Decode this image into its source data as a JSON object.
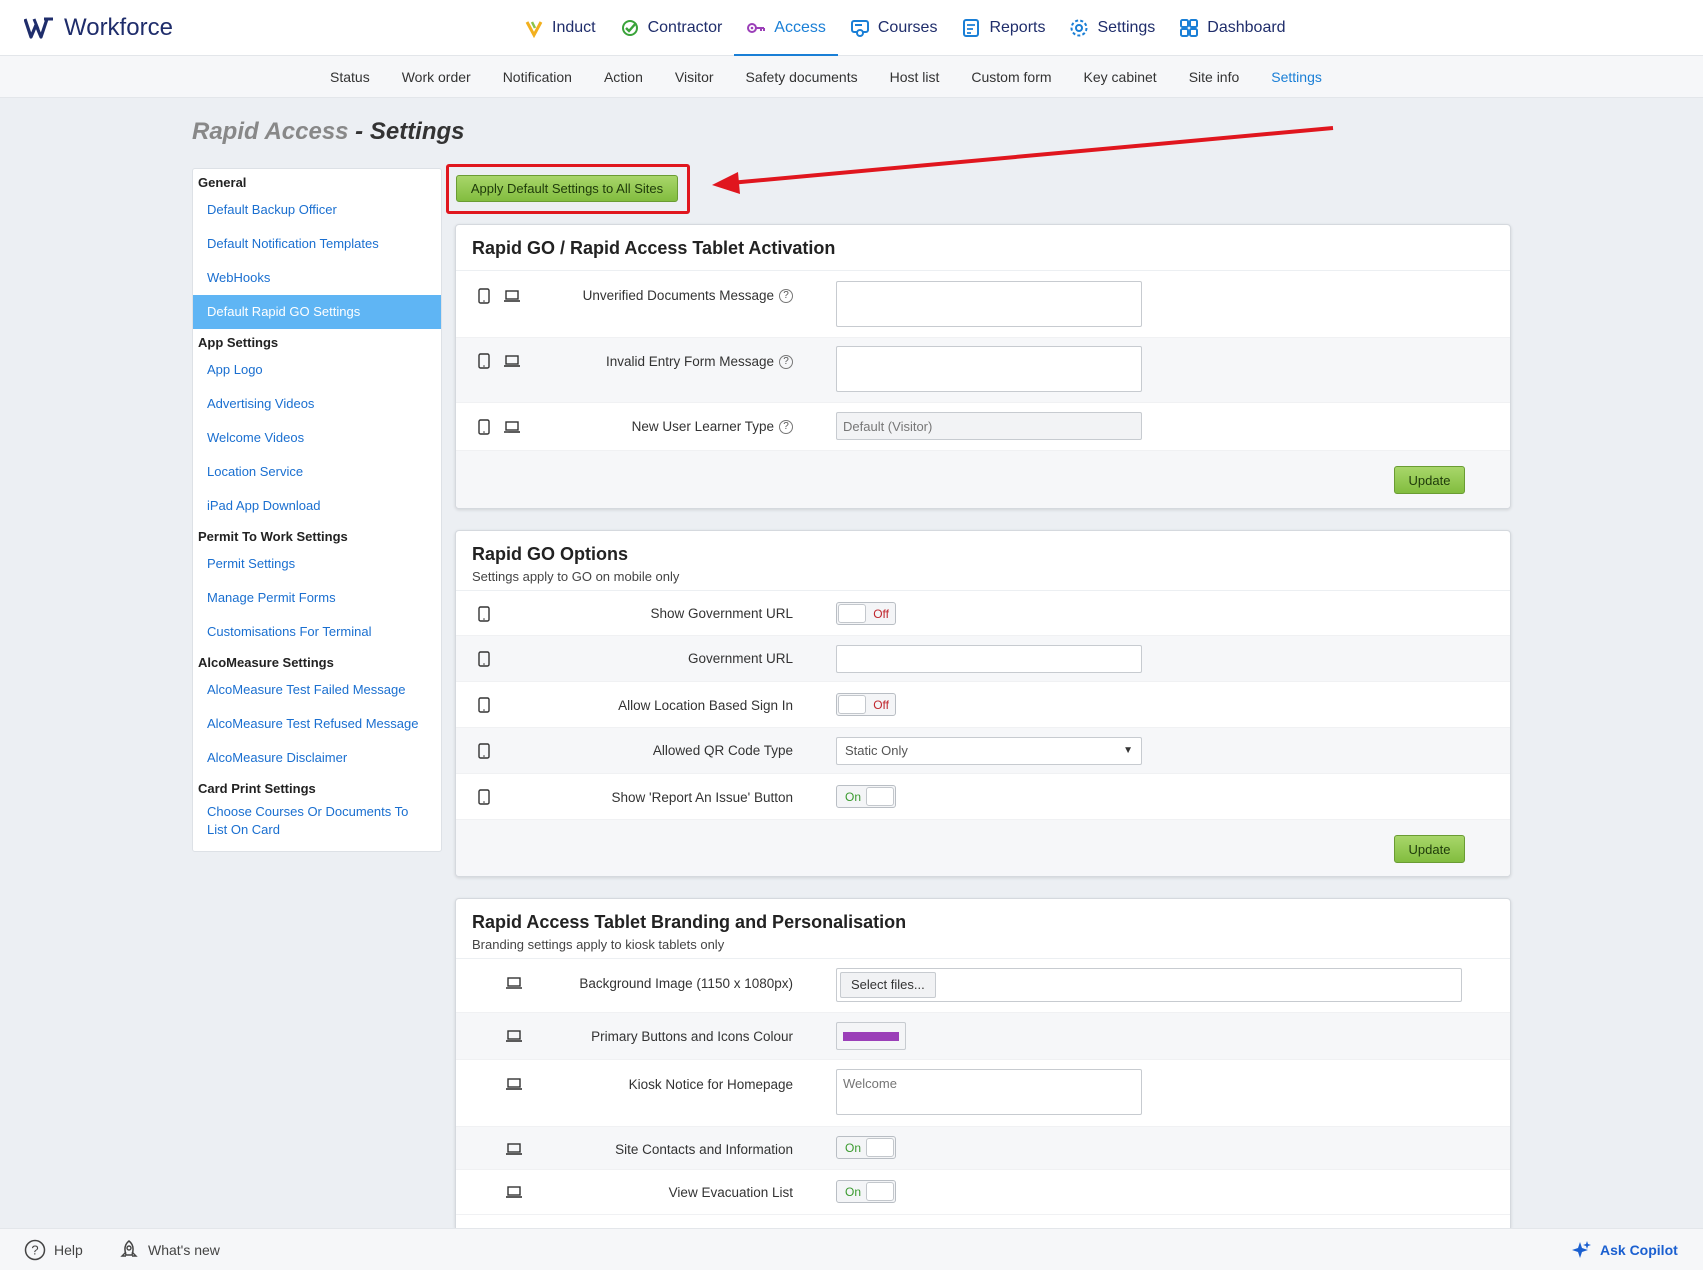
{
  "brand": {
    "name": "Workforce"
  },
  "main_nav": [
    {
      "label": "Induct",
      "icon": "induct-icon",
      "color": "#f2b01e"
    },
    {
      "label": "Contractor",
      "icon": "check-circle-icon",
      "color": "#3aa33a"
    },
    {
      "label": "Access",
      "icon": "key-icon",
      "color": "#9b3fb8"
    },
    {
      "label": "Courses",
      "icon": "courses-icon",
      "color": "#1a7fd6"
    },
    {
      "label": "Reports",
      "icon": "reports-icon",
      "color": "#1a7fd6"
    },
    {
      "label": "Settings",
      "icon": "gear-icon",
      "color": "#1a7fd6"
    },
    {
      "label": "Dashboard",
      "icon": "dashboard-icon",
      "color": "#1a7fd6"
    }
  ],
  "sub_nav": [
    "Status",
    "Work order",
    "Notification",
    "Action",
    "Visitor",
    "Safety documents",
    "Host list",
    "Custom form",
    "Key cabinet",
    "Site info",
    "Settings"
  ],
  "page_title": {
    "prefix": "Rapid Access",
    "separator": " - ",
    "suffix": "Settings"
  },
  "sidebar": {
    "groups": [
      {
        "title": "General",
        "links": [
          "Default Backup Officer",
          "Default Notification Templates",
          "WebHooks",
          "Default Rapid GO Settings"
        ]
      },
      {
        "title": "App Settings",
        "links": [
          "App Logo",
          "Advertising Videos",
          "Welcome Videos",
          "Location Service",
          "iPad App Download"
        ]
      },
      {
        "title": "Permit To Work Settings",
        "links": [
          "Permit Settings",
          "Manage Permit Forms",
          "Customisations For Terminal"
        ]
      },
      {
        "title": "AlcoMeasure Settings",
        "links": [
          "AlcoMeasure Test Failed Message",
          "AlcoMeasure Test Refused Message",
          "AlcoMeasure Disclaimer"
        ]
      },
      {
        "title": "Card Print Settings",
        "links": [
          "Choose Courses Or Documents To List On Card"
        ]
      }
    ]
  },
  "apply_button": "Apply Default Settings to All Sites",
  "panel1": {
    "title": "Rapid GO / Rapid Access Tablet Activation",
    "rows": [
      {
        "label": "Unverified Documents Message",
        "value": ""
      },
      {
        "label": "Invalid Entry Form Message",
        "value": ""
      },
      {
        "label": "New User Learner Type",
        "value": "Default (Visitor)"
      }
    ],
    "update": "Update"
  },
  "panel2": {
    "title": "Rapid GO Options",
    "subtitle": "Settings apply to GO on mobile only",
    "rows": [
      {
        "label": "Show Government URL",
        "toggle": "Off"
      },
      {
        "label": "Government URL",
        "value": ""
      },
      {
        "label": "Allow Location Based Sign In",
        "toggle": "Off"
      },
      {
        "label": "Allowed QR Code Type",
        "value": "Static Only"
      },
      {
        "label": "Show 'Report An Issue' Button",
        "toggle": "On"
      }
    ],
    "update": "Update"
  },
  "panel3": {
    "title": "Rapid Access Tablet Branding and Personalisation",
    "subtitle": "Branding settings apply to kiosk tablets only",
    "rows": [
      {
        "label": "Background Image (1150 x 1080px)",
        "button": "Select files..."
      },
      {
        "label": "Primary Buttons and Icons Colour",
        "color": "#9b3fb8"
      },
      {
        "label": "Kiosk Notice for Homepage",
        "placeholder": "Welcome"
      },
      {
        "label": "Site Contacts and Information",
        "toggle": "On"
      },
      {
        "label": "View Evacuation List",
        "toggle": "On"
      }
    ]
  },
  "footer": {
    "help": "Help",
    "whats_new": "What's new",
    "copilot": "Ask Copilot"
  }
}
